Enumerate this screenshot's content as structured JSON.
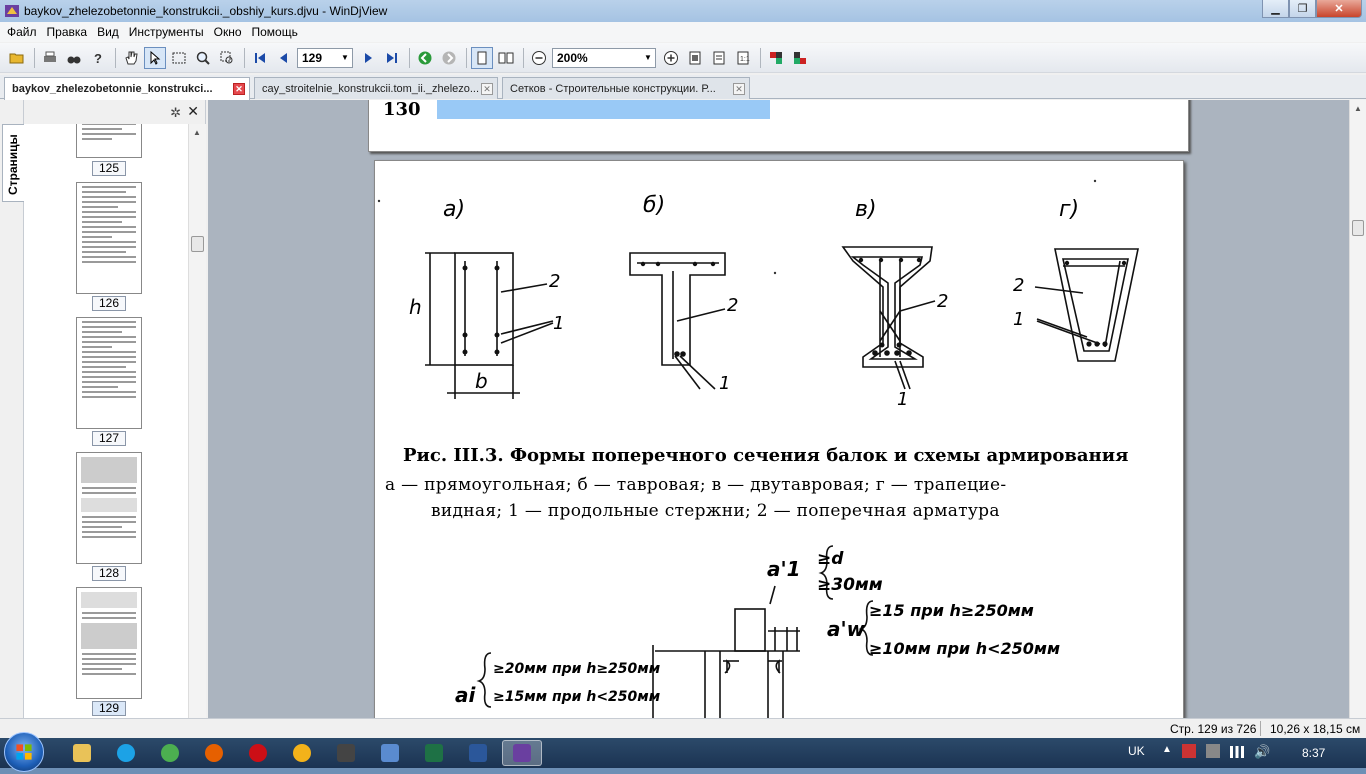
{
  "window": {
    "title": "baykov_zhelezobetonnie_konstrukcii._obshiy_kurs.djvu - WinDjView"
  },
  "menu": [
    "Файл",
    "Правка",
    "Вид",
    "Инструменты",
    "Окно",
    "Помощь"
  ],
  "toolbar": {
    "page_value": "129",
    "zoom_value": "200%"
  },
  "tabs": [
    {
      "label": "baykov_zhelezobetonnie_konstrukci...",
      "active": true
    },
    {
      "label": "cay_stroitelnie_konstrukcii.tom_ii._zhelezo...",
      "active": false
    },
    {
      "label": "Сетков - Строительные конструкции. Р...",
      "active": false
    }
  ],
  "sidebar": {
    "tab_label": "Страницы",
    "thumbnails": [
      "125",
      "126",
      "127",
      "128",
      "129"
    ]
  },
  "document": {
    "prev_page_number": "130",
    "figure_labels": {
      "a": "а)",
      "b": "б)",
      "v": "в)",
      "g": "г)"
    },
    "dim_h": "h",
    "dim_b": "b",
    "num_1": "1",
    "num_2": "2",
    "caption_title": "Рис. III.3. Формы поперечного сечения балок и схемы армирования",
    "caption_line1": "а — прямоугольная;  б — тавровая;  в — двутавровая;  г — трапецие-",
    "caption_line2": "видная;  1 — продольные стержни;  2 — поперечная арматура",
    "lower_figure": {
      "a1_label": "a'1",
      "a1_opt1": "≥d",
      "a1_opt2": "≥30мм",
      "aw_label": "a'w",
      "aw_opt1": "≥15 при h≥250мм",
      "aw_opt2": "≥10мм при h<250мм",
      "ai_label": "ai",
      "ai_opt1": "≥20мм при h≥250мм",
      "ai_opt2": "≥15мм при h<250мм"
    }
  },
  "status": {
    "page_info": "Стр. 129 из 726",
    "page_size": "10,26 x 18,15 см"
  },
  "taskbar": {
    "language": "UK",
    "clock": "8:37"
  }
}
